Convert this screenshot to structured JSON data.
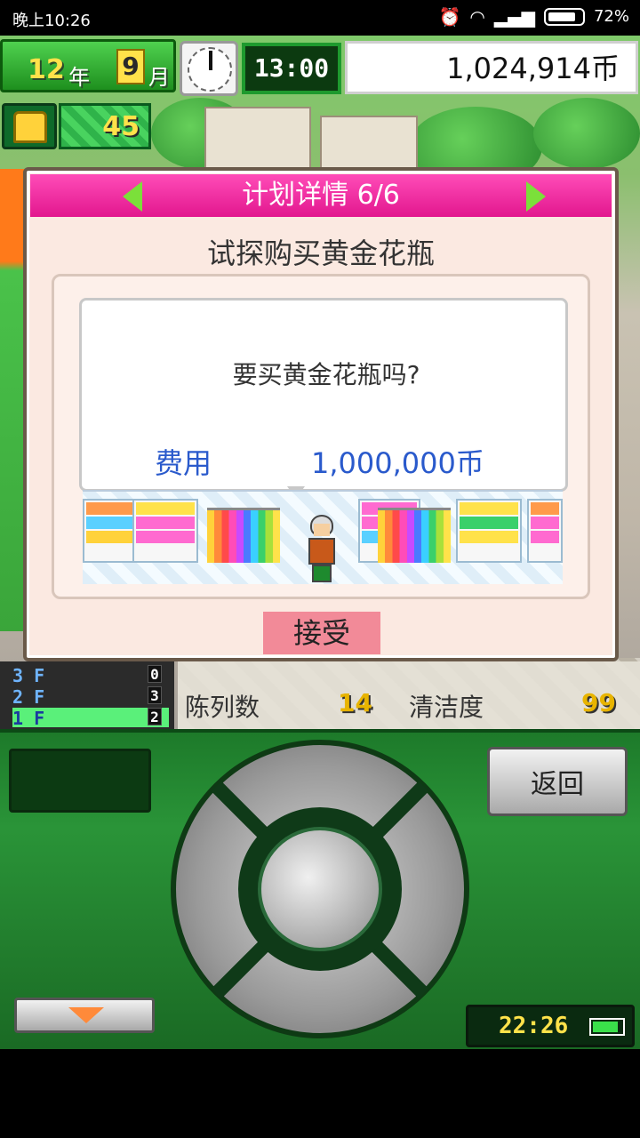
{
  "statusbar": {
    "time": "晚上10:26",
    "battery": "72%",
    "icons": [
      "alarm-icon",
      "wifi-icon",
      "signal-icon",
      "battery-icon"
    ]
  },
  "hud": {
    "year": "12",
    "year_unit": "年",
    "month": "9",
    "month_unit": "月",
    "time": "13:00",
    "money": "1,024,914币",
    "points": "45"
  },
  "dialog": {
    "header": "计划详情 6/6",
    "subtitle": "试探购买黄金花瓶",
    "question": "要买黄金花瓶吗?",
    "cost_label": "费用",
    "cost_value": "1,000,000币",
    "accept": "接受"
  },
  "floors": [
    {
      "label": "3 F",
      "count": "0"
    },
    {
      "label": "2 F",
      "count": "3"
    },
    {
      "label": "1 F",
      "count": "2"
    }
  ],
  "stats": {
    "display_label": "陈列数",
    "display_value": "14",
    "clean_label": "清洁度",
    "clean_value": "99"
  },
  "controller": {
    "back": "返回",
    "clock": "22:26"
  },
  "colors": {
    "header": "#e2178e",
    "accent_green": "#2a9438",
    "money_text": "#2a5acc",
    "accept_btn": "#f28a98"
  }
}
